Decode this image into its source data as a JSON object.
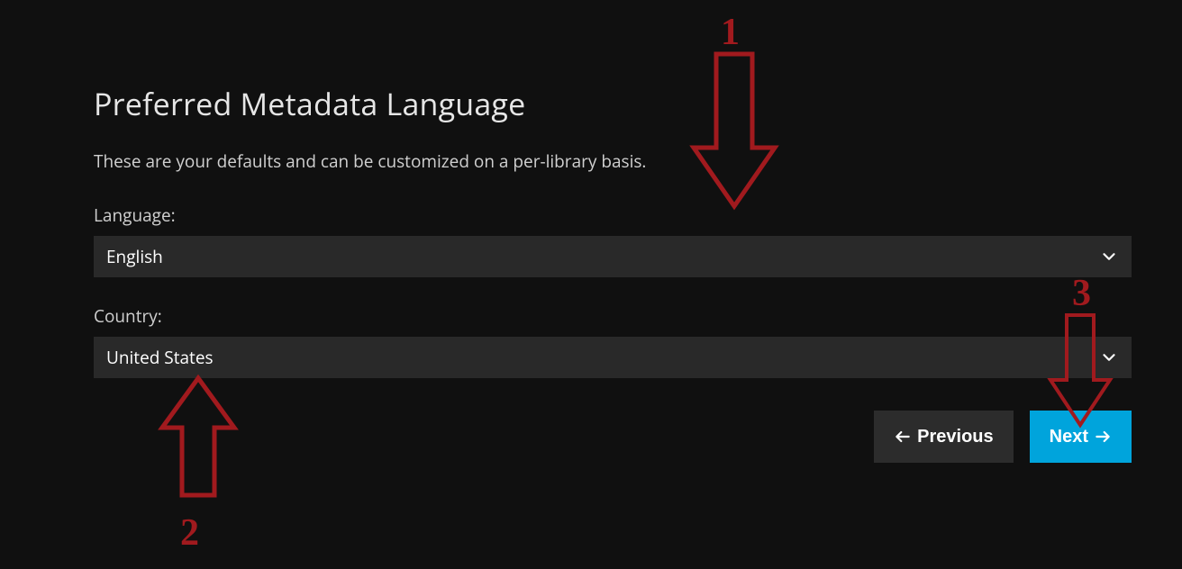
{
  "page": {
    "title": "Preferred Metadata Language",
    "subtitle": "These are your defaults and can be customized on a per-library basis."
  },
  "form": {
    "language": {
      "label": "Language:",
      "value": "English"
    },
    "country": {
      "label": "Country:",
      "value": "United States"
    }
  },
  "buttons": {
    "previous": "Previous",
    "next": "Next"
  },
  "annotations": {
    "one": "1",
    "two": "2",
    "three": "3"
  }
}
